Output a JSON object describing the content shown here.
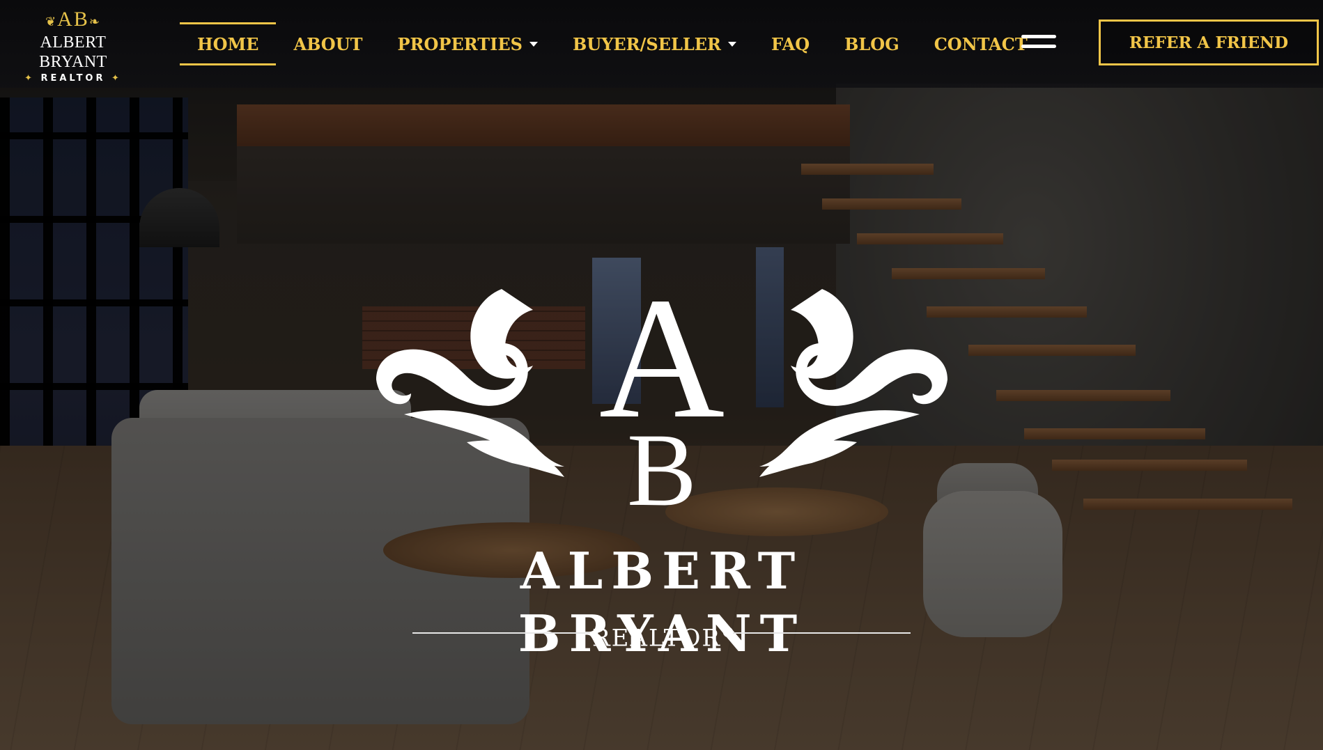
{
  "logo": {
    "monogram": "AB",
    "name": "ALBERT BRYANT",
    "subtitle": "REALTOR"
  },
  "nav": {
    "items": [
      {
        "label": "HOME",
        "active": true,
        "has_dropdown": false
      },
      {
        "label": "ABOUT",
        "active": false,
        "has_dropdown": false
      },
      {
        "label": "PROPERTIES",
        "active": false,
        "has_dropdown": true
      },
      {
        "label": "BUYER/SELLER",
        "active": false,
        "has_dropdown": true
      },
      {
        "label": "FAQ",
        "active": false,
        "has_dropdown": false
      },
      {
        "label": "BLOG",
        "active": false,
        "has_dropdown": false
      },
      {
        "label": "CONTACT",
        "active": false,
        "has_dropdown": false
      }
    ],
    "menu_icon": "hamburger-menu-icon",
    "cta_label": "REFER A FRIEND"
  },
  "hero": {
    "monogram_a": "A",
    "monogram_b": "B",
    "name": "ALBERT BRYANT",
    "subtitle": "REALTOR",
    "registered_mark": "®"
  },
  "colors": {
    "accent_gold": "#f1c548",
    "header_bg": "#0f0f12",
    "text_white": "#ffffff"
  }
}
